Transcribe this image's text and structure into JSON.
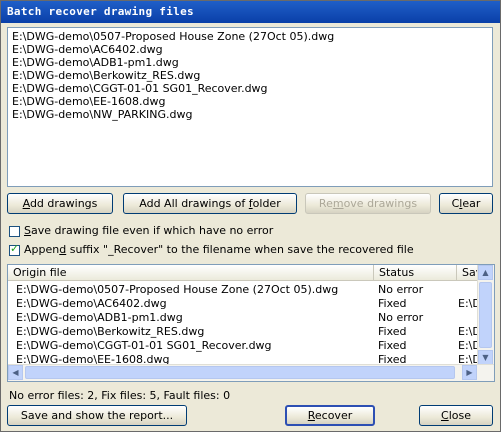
{
  "window": {
    "title": "Batch recover drawing files"
  },
  "files": [
    "E:\\DWG-demo\\0507-Proposed House Zone (27Oct 05).dwg",
    "E:\\DWG-demo\\AC6402.dwg",
    "E:\\DWG-demo\\ADB1-pm1.dwg",
    "E:\\DWG-demo\\Berkowitz_RES.dwg",
    "E:\\DWG-demo\\CGGT-01-01 SG01_Recover.dwg",
    "E:\\DWG-demo\\EE-1608.dwg",
    "E:\\DWG-demo\\NW_PARKING.dwg"
  ],
  "buttons": {
    "add_drawings_accel": "A",
    "add_drawings_rest": "dd drawings",
    "add_all_pre": "Add All drawings of ",
    "add_all_accel": "f",
    "add_all_post": "older",
    "remove_pre": "Re",
    "remove_accel": "m",
    "remove_post": "ove drawings",
    "clear_pre": "C",
    "clear_accel": "l",
    "clear_post": "ear",
    "save_report": "Save and show the report...",
    "recover_accel": "R",
    "recover_rest": "ecover",
    "close_accel": "C",
    "close_rest": "lose"
  },
  "options": {
    "save_no_error": {
      "accel": "S",
      "rest": "ave drawing file even if which have no error",
      "checked": false
    },
    "append_suffix": {
      "pre": "Appen",
      "accel": "d",
      "rest": " suffix \"_Recover\" to the filename when save the recovered file",
      "checked": true
    }
  },
  "results": {
    "columns": [
      "Origin file",
      "Status",
      "Save"
    ],
    "rows": [
      {
        "file": "E:\\DWG-demo\\0507-Proposed House Zone (27Oct 05).dwg",
        "status": "No error",
        "save": ""
      },
      {
        "file": "E:\\DWG-demo\\AC6402.dwg",
        "status": "Fixed",
        "save": "E:\\D"
      },
      {
        "file": "E:\\DWG-demo\\ADB1-pm1.dwg",
        "status": "No error",
        "save": ""
      },
      {
        "file": "E:\\DWG-demo\\Berkowitz_RES.dwg",
        "status": "Fixed",
        "save": "E:\\D"
      },
      {
        "file": "E:\\DWG-demo\\CGGT-01-01 SG01_Recover.dwg",
        "status": "Fixed",
        "save": "E:\\D"
      },
      {
        "file": "E:\\DWG-demo\\EE-1608.dwg",
        "status": "Fixed",
        "save": "E:\\D"
      }
    ]
  },
  "summary": "No error files: 2, Fix files: 5, Fault files: 0",
  "colors": {
    "titlebar": "#0a3fa8",
    "checkmark": "#21a121",
    "dialog_bg": "#ece9d8"
  }
}
